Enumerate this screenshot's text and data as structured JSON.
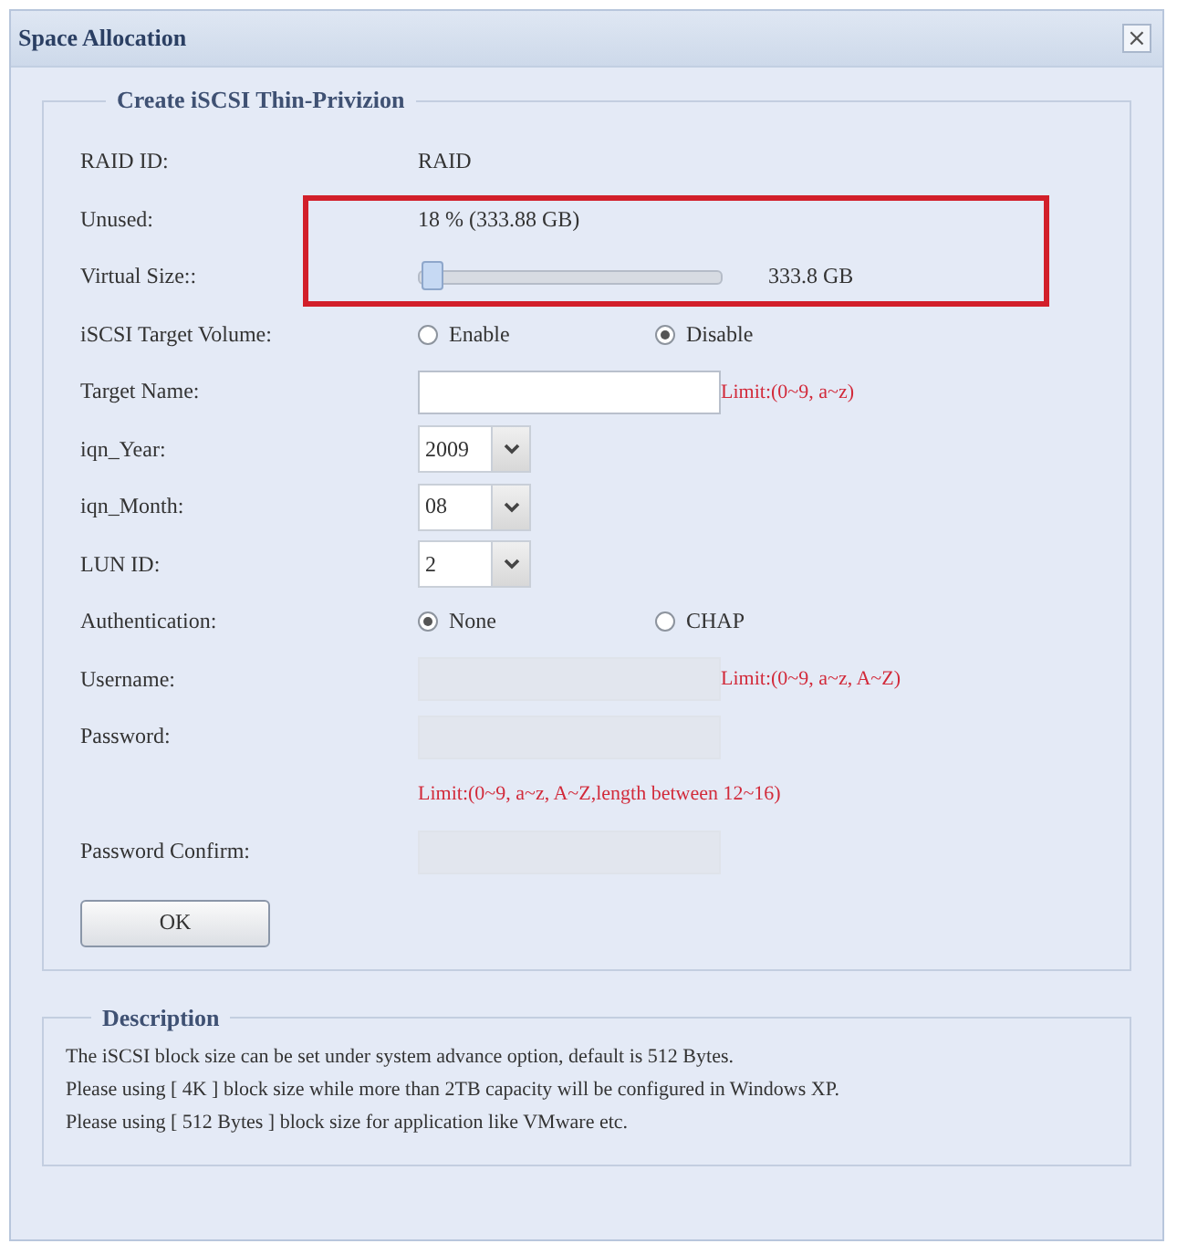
{
  "dialog": {
    "title": "Space Allocation",
    "close_symbol": "×"
  },
  "form": {
    "legend": "Create iSCSI Thin-Privizion",
    "rows": [
      {
        "kind": "text",
        "label": "RAID ID:",
        "value": "RAID",
        "highlighted": false
      },
      {
        "kind": "text",
        "label": "Unused:",
        "value": "18 % (333.88 GB)",
        "highlighted": true
      },
      {
        "kind": "slider",
        "label": "Virtual Size::",
        "level": 0.04,
        "reading": "333.8 GB",
        "highlighted": true
      },
      {
        "kind": "radio",
        "label": "iSCSI Target Volume:",
        "options": [
          {
            "label": "Enable",
            "selected": false
          },
          {
            "label": "Disable",
            "selected": true
          }
        ],
        "highlighted": false
      },
      {
        "kind": "input",
        "label": "Target Name:",
        "hint": "Limit:(0~9, a~z)",
        "disabled": false,
        "highlighted": false
      },
      {
        "kind": "select",
        "label": "iqn_Year:",
        "value": "2009",
        "highlighted": false
      },
      {
        "kind": "select",
        "label": "iqn_Month:",
        "value": "08",
        "highlighted": false
      },
      {
        "kind": "select",
        "label": "LUN ID:",
        "value": "2",
        "highlighted": false
      },
      {
        "kind": "radio",
        "label": "Authentication:",
        "options": [
          {
            "label": "None",
            "selected": true
          },
          {
            "label": "CHAP",
            "selected": false
          }
        ],
        "highlighted": false
      },
      {
        "kind": "input",
        "label": "Username:",
        "hint": "Limit:(0~9, a~z, A~Z)",
        "disabled": true,
        "highlighted": false
      },
      {
        "kind": "input",
        "label": "Password:",
        "disabled": true,
        "highlighted": false
      },
      {
        "kind": "note",
        "text": "Limit:(0~9, a~z, A~Z,length between 12~16)",
        "highlighted": false
      },
      {
        "kind": "input",
        "label": "Password Confirm:",
        "disabled": true,
        "highlighted": false
      }
    ],
    "button": "OK"
  },
  "description": {
    "legend": "Description",
    "lines": [
      "The iSCSI block size can be set under system advance option, default is 512 Bytes.",
      "Please using [ 4K ] block size while more than 2TB capacity will be configured in Windows XP.",
      "Please using [ 512 Bytes ] block size for application like VMware etc."
    ]
  }
}
